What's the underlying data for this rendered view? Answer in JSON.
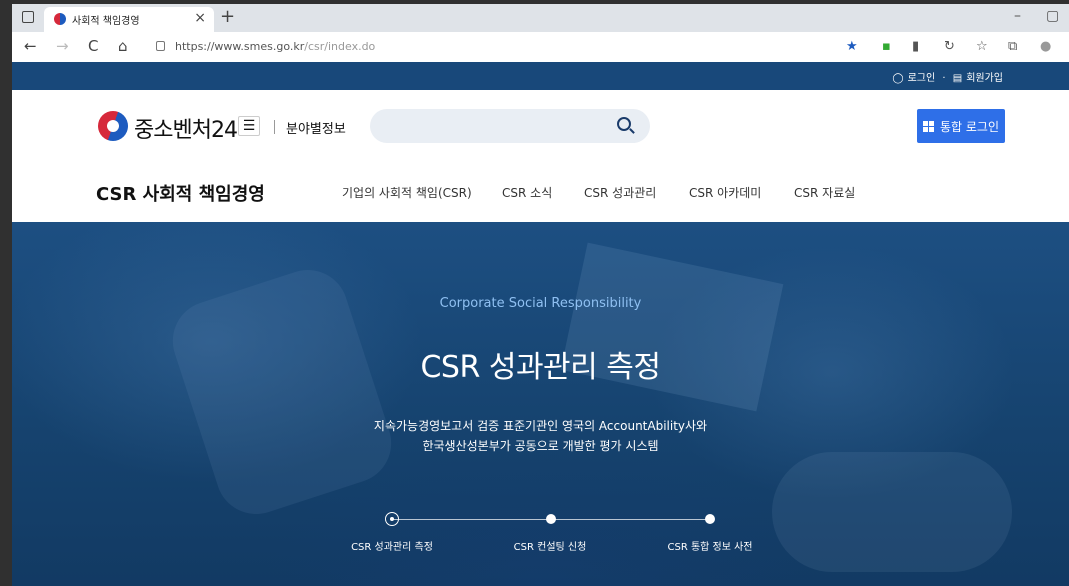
{
  "browser": {
    "tab_title": "사회적 책임경영",
    "new_tab": "+",
    "close_tab": "×",
    "window_min": "–",
    "window_max": "▢",
    "back": "←",
    "forward": "→",
    "reload": "C",
    "home": "⌂",
    "url_host": "https://www.smes.go.kr",
    "url_path": "/csr/index.do"
  },
  "util_bar": {
    "login": "로그인",
    "signup": "회원가입"
  },
  "header": {
    "logo_text": "중소벤처24",
    "menu_icon": "☰",
    "field_info": "분야별정보",
    "search_value": "",
    "unified_login": "통합 로그인"
  },
  "subnav": {
    "brand": "CSR 사회적 책임경영",
    "items": [
      "기업의 사회적 책임(CSR)",
      "CSR 소식",
      "CSR 성과관리",
      "CSR 아카데미",
      "CSR 자료실"
    ]
  },
  "hero": {
    "eyebrow": "Corporate Social Responsibility",
    "headline": "CSR 성과관리 측정",
    "desc_line1": "지속가능경영보고서 검증 표준기관인 영국의 AccountAbility사와",
    "desc_line2": "한국생산성본부가 공동으로 개발한 평가 시스템",
    "steps": [
      "CSR 성과관리 측정",
      "CSR 컨설팅 신청",
      "CSR 통합 정보 사전"
    ]
  },
  "colors": {
    "util_bar": "#18487a",
    "login_button": "#2e6fe8",
    "hero_bg": "#16436f",
    "eyebrow": "#8fc0f2"
  }
}
